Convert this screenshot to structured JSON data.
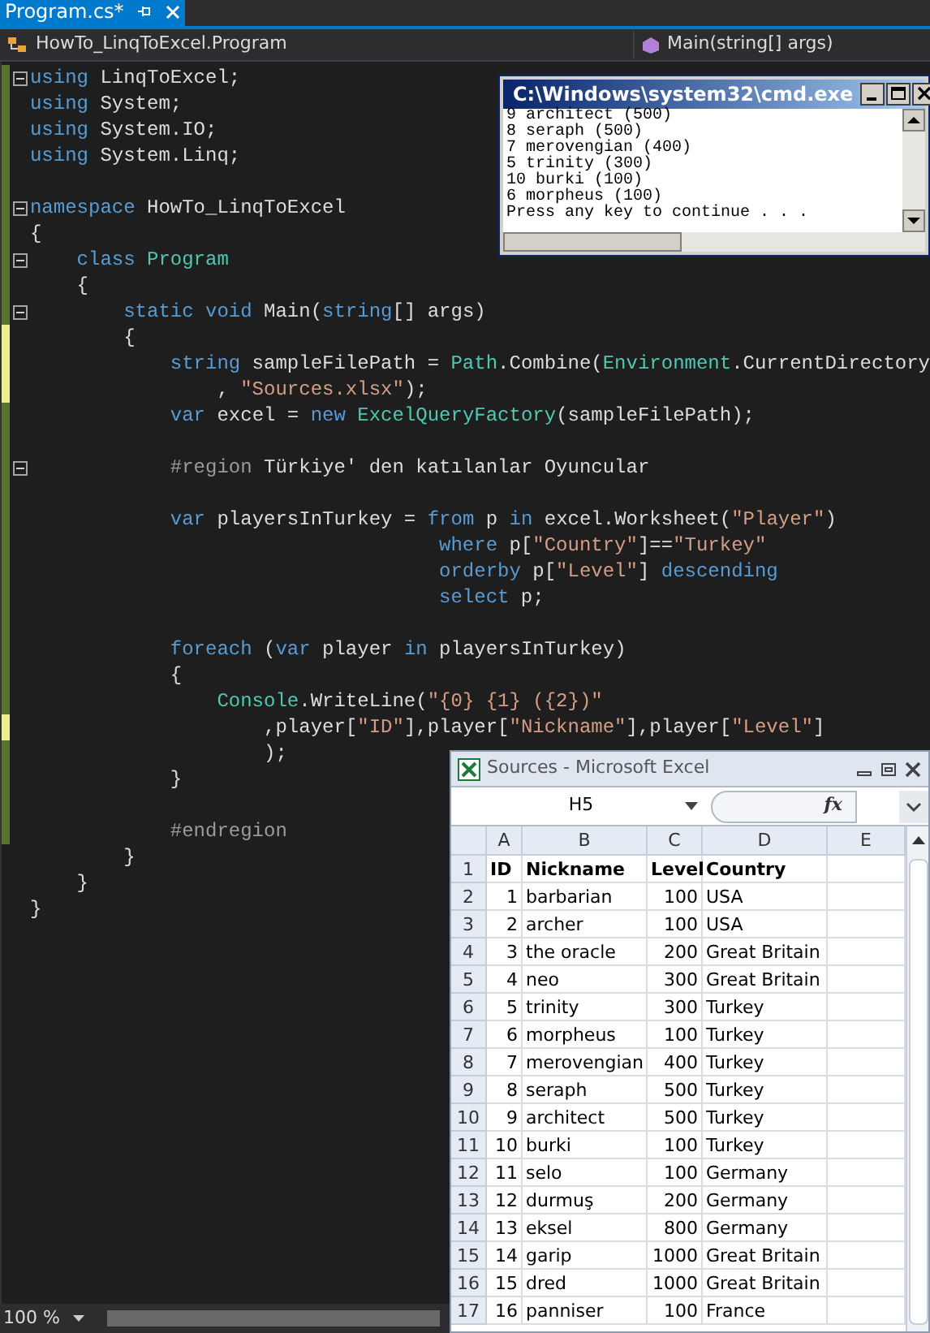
{
  "tab": {
    "title": "Program.cs*",
    "selected": true
  },
  "nav": {
    "class_selector": "HowTo_LinqToExcel.Program",
    "member_selector": "Main(string[] args)"
  },
  "code_lines": [
    {
      "outline": true,
      "changed": true,
      "saved": true,
      "tokens": [
        {
          "kind": "keyword",
          "text": "using"
        },
        {
          "kind": "plain",
          "text": " LinqToExcel;"
        }
      ]
    },
    {
      "outline": false,
      "changed": true,
      "saved": true,
      "tokens": [
        {
          "kind": "keyword",
          "text": "using"
        },
        {
          "kind": "plain",
          "text": " System;"
        }
      ]
    },
    {
      "outline": false,
      "changed": true,
      "saved": true,
      "tokens": [
        {
          "kind": "keyword",
          "text": "using"
        },
        {
          "kind": "plain",
          "text": " System.IO;"
        }
      ]
    },
    {
      "outline": false,
      "changed": true,
      "saved": true,
      "tokens": [
        {
          "kind": "keyword",
          "text": "using"
        },
        {
          "kind": "plain",
          "text": " System.Linq;"
        }
      ]
    },
    {
      "outline": false,
      "changed": true,
      "saved": true
    },
    {
      "outline": true,
      "changed": true,
      "saved": true,
      "tokens": [
        {
          "kind": "keyword",
          "text": "namespace"
        },
        {
          "kind": "plain",
          "text": " HowTo_LinqToExcel"
        }
      ]
    },
    {
      "outline": false,
      "changed": true,
      "saved": true,
      "tokens": [
        {
          "kind": "plain",
          "text": "{"
        }
      ]
    },
    {
      "outline": true,
      "changed": true,
      "saved": true,
      "tokens": [
        {
          "kind": "keyword",
          "text": "    class"
        },
        {
          "kind": "type",
          "text": " Program"
        }
      ]
    },
    {
      "outline": false,
      "changed": true,
      "saved": true,
      "tokens": [
        {
          "kind": "plain",
          "text": "    {"
        }
      ]
    },
    {
      "outline": true,
      "changed": true,
      "saved": true,
      "tokens": [
        {
          "kind": "keyword",
          "text": "        static void"
        },
        {
          "kind": "plain",
          "text": " Main("
        },
        {
          "kind": "keyword",
          "text": "string"
        },
        {
          "kind": "plain",
          "text": "[] args)"
        }
      ]
    },
    {
      "outline": false,
      "changed": true,
      "saved": false,
      "tokens": [
        {
          "kind": "plain",
          "text": "        {"
        }
      ]
    },
    {
      "outline": false,
      "changed": true,
      "saved": false,
      "tokens": [
        {
          "kind": "keyword",
          "text": "            string"
        },
        {
          "kind": "plain",
          "text": " sampleFilePath = "
        },
        {
          "kind": "type",
          "text": "Path"
        },
        {
          "kind": "plain",
          "text": ".Combine("
        },
        {
          "kind": "type",
          "text": "Environment"
        },
        {
          "kind": "plain",
          "text": ".CurrentDirectory"
        }
      ]
    },
    {
      "outline": false,
      "changed": true,
      "saved": false,
      "tokens": [
        {
          "kind": "plain",
          "text": "                , "
        },
        {
          "kind": "string",
          "text": "\"Sources.xlsx\""
        },
        {
          "kind": "plain",
          "text": ");"
        }
      ]
    },
    {
      "outline": false,
      "changed": true,
      "saved": true,
      "tokens": [
        {
          "kind": "keyword",
          "text": "            var"
        },
        {
          "kind": "plain",
          "text": " excel = "
        },
        {
          "kind": "keyword",
          "text": "new"
        },
        {
          "kind": "type",
          "text": " ExcelQueryFactory"
        },
        {
          "kind": "plain",
          "text": "(sampleFilePath);"
        }
      ]
    },
    {
      "outline": false,
      "changed": true,
      "saved": true
    },
    {
      "outline": true,
      "changed": true,
      "saved": true,
      "tokens": [
        {
          "kind": "directive",
          "text": "            #region"
        },
        {
          "kind": "plain",
          "text": " Türkiye' den katılanlar Oyuncular"
        }
      ]
    },
    {
      "outline": false,
      "changed": true,
      "saved": true
    },
    {
      "outline": false,
      "changed": true,
      "saved": true,
      "tokens": [
        {
          "kind": "keyword",
          "text": "            var"
        },
        {
          "kind": "plain",
          "text": " playersInTurkey = "
        },
        {
          "kind": "keyword",
          "text": "from"
        },
        {
          "kind": "plain",
          "text": " p "
        },
        {
          "kind": "keyword",
          "text": "in"
        },
        {
          "kind": "plain",
          "text": " excel.Worksheet("
        },
        {
          "kind": "string",
          "text": "\"Player\""
        },
        {
          "kind": "plain",
          "text": ")"
        }
      ]
    },
    {
      "outline": false,
      "changed": true,
      "saved": true,
      "tokens": [
        {
          "kind": "keyword",
          "text": "                                   where"
        },
        {
          "kind": "plain",
          "text": " p["
        },
        {
          "kind": "string",
          "text": "\"Country\""
        },
        {
          "kind": "plain",
          "text": "]=="
        },
        {
          "kind": "string",
          "text": "\"Turkey\""
        }
      ]
    },
    {
      "outline": false,
      "changed": true,
      "saved": true,
      "tokens": [
        {
          "kind": "keyword",
          "text": "                                   orderby"
        },
        {
          "kind": "plain",
          "text": " p["
        },
        {
          "kind": "string",
          "text": "\"Level\""
        },
        {
          "kind": "plain",
          "text": "]"
        },
        {
          "kind": "keyword",
          "text": " descending"
        }
      ]
    },
    {
      "outline": false,
      "changed": true,
      "saved": true,
      "tokens": [
        {
          "kind": "keyword",
          "text": "                                   select"
        },
        {
          "kind": "plain",
          "text": " p;"
        }
      ]
    },
    {
      "outline": false,
      "changed": true,
      "saved": true
    },
    {
      "outline": false,
      "changed": true,
      "saved": true,
      "tokens": [
        {
          "kind": "keyword",
          "text": "            foreach"
        },
        {
          "kind": "plain",
          "text": " ("
        },
        {
          "kind": "keyword",
          "text": "var"
        },
        {
          "kind": "plain",
          "text": " player "
        },
        {
          "kind": "keyword",
          "text": "in"
        },
        {
          "kind": "plain",
          "text": " playersInTurkey)"
        }
      ]
    },
    {
      "outline": false,
      "changed": true,
      "saved": true,
      "tokens": [
        {
          "kind": "plain",
          "text": "            {"
        }
      ]
    },
    {
      "outline": false,
      "changed": true,
      "saved": true,
      "tokens": [
        {
          "kind": "type",
          "text": "                Console"
        },
        {
          "kind": "plain",
          "text": ".WriteLine("
        },
        {
          "kind": "string",
          "text": "\"{0} {1} ({2})\""
        }
      ]
    },
    {
      "outline": false,
      "changed": true,
      "saved": false,
      "tokens": [
        {
          "kind": "plain",
          "text": "                    ,player["
        },
        {
          "kind": "string",
          "text": "\"ID\""
        },
        {
          "kind": "plain",
          "text": "],player["
        },
        {
          "kind": "string",
          "text": "\"Nickname\""
        },
        {
          "kind": "plain",
          "text": "],player["
        },
        {
          "kind": "string",
          "text": "\"Level\""
        },
        {
          "kind": "plain",
          "text": "]"
        }
      ]
    },
    {
      "outline": false,
      "changed": true,
      "saved": true,
      "tokens": [
        {
          "kind": "plain",
          "text": "                    );"
        }
      ]
    },
    {
      "outline": false,
      "changed": true,
      "saved": true,
      "tokens": [
        {
          "kind": "plain",
          "text": "            }"
        }
      ]
    },
    {
      "outline": false,
      "changed": true,
      "saved": true
    },
    {
      "outline": false,
      "changed": true,
      "saved": true,
      "tokens": [
        {
          "kind": "directive",
          "text": "            #endregion"
        }
      ]
    },
    {
      "outline": false,
      "changed": false,
      "tokens": [
        {
          "kind": "plain",
          "text": "        }"
        }
      ]
    },
    {
      "outline": false,
      "changed": false,
      "tokens": [
        {
          "kind": "plain",
          "text": "    }"
        }
      ]
    },
    {
      "outline": false,
      "changed": false,
      "tokens": [
        {
          "kind": "plain",
          "text": "}"
        }
      ]
    }
  ],
  "status_bar": {
    "zoom": "100 %"
  },
  "console_window": {
    "title": "C:\\Windows\\system32\\cmd.exe",
    "lines": [
      "9 architect (500)",
      "8 seraph (500)",
      "7 merovengian (400)",
      "5 trinity (300)",
      "10 burki (100)",
      "6 morpheus (100)",
      "Press any key to continue . . ."
    ]
  },
  "excel_window": {
    "title": "Sources - Microsoft Excel",
    "name_box": "H5",
    "function_button": "fx",
    "columns": [
      "A",
      "B",
      "C",
      "D",
      "E"
    ],
    "rows": [
      {
        "header": "1",
        "bold": true,
        "cells": [
          "ID",
          "Nickname",
          "Level",
          "Country"
        ]
      },
      {
        "header": "2",
        "bold": false,
        "cells": [
          "1",
          "barbarian",
          "100",
          "USA"
        ]
      },
      {
        "header": "3",
        "bold": false,
        "cells": [
          "2",
          "archer",
          "100",
          "USA"
        ]
      },
      {
        "header": "4",
        "bold": false,
        "cells": [
          "3",
          "the oracle",
          "200",
          "Great Britain"
        ]
      },
      {
        "header": "5",
        "bold": false,
        "cells": [
          "4",
          "neo",
          "300",
          "Great Britain"
        ]
      },
      {
        "header": "6",
        "bold": false,
        "cells": [
          "5",
          "trinity",
          "300",
          "Turkey"
        ]
      },
      {
        "header": "7",
        "bold": false,
        "cells": [
          "6",
          "morpheus",
          "100",
          "Turkey"
        ]
      },
      {
        "header": "8",
        "bold": false,
        "cells": [
          "7",
          "merovengian",
          "400",
          "Turkey"
        ]
      },
      {
        "header": "9",
        "bold": false,
        "cells": [
          "8",
          "seraph",
          "500",
          "Turkey"
        ]
      },
      {
        "header": "10",
        "bold": false,
        "cells": [
          "9",
          "architect",
          "500",
          "Turkey"
        ]
      },
      {
        "header": "11",
        "bold": false,
        "cells": [
          "10",
          "burki",
          "100",
          "Turkey"
        ]
      },
      {
        "header": "12",
        "bold": false,
        "cells": [
          "11",
          "selo",
          "100",
          "Germany"
        ]
      },
      {
        "header": "13",
        "bold": false,
        "cells": [
          "12",
          "durmuş",
          "200",
          "Germany"
        ]
      },
      {
        "header": "14",
        "bold": false,
        "cells": [
          "13",
          "eksel",
          "800",
          "Germany"
        ]
      },
      {
        "header": "15",
        "bold": false,
        "cells": [
          "14",
          "garip",
          "1000",
          "Great Britain"
        ]
      },
      {
        "header": "16",
        "bold": false,
        "cells": [
          "15",
          "dred",
          "1000",
          "Great Britain"
        ]
      },
      {
        "header": "17",
        "bold": false,
        "cells": [
          "16",
          "panniser",
          "100",
          "France"
        ]
      }
    ]
  }
}
